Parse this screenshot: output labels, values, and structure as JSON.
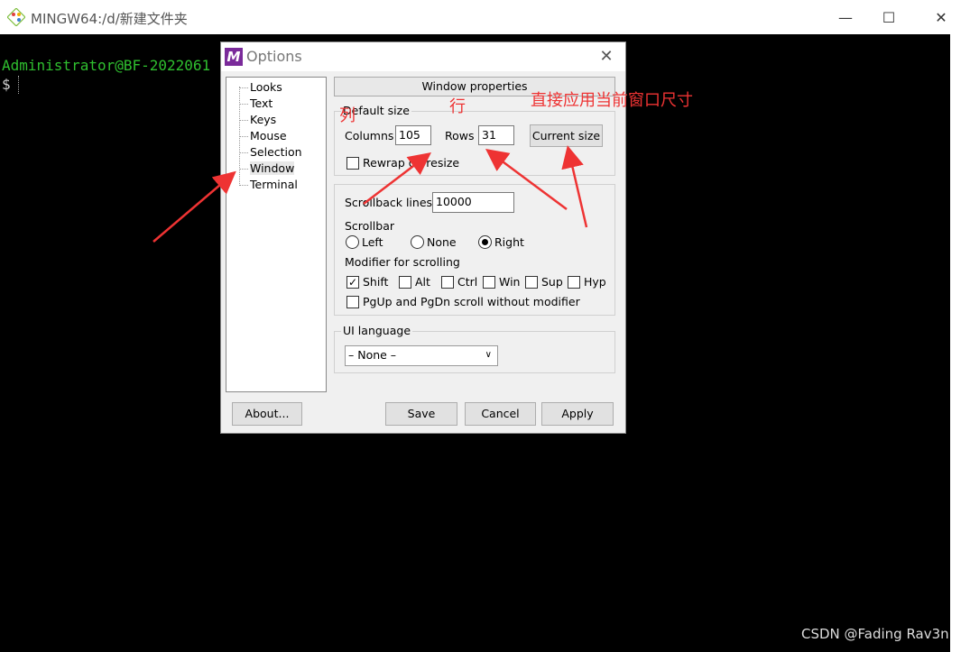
{
  "window": {
    "title": "MINGW64:/d/新建文件夹",
    "minimize": "—",
    "maximize": "☐",
    "close": "✕"
  },
  "terminal": {
    "line1": "Administrator@BF-2022061",
    "prompt": "$"
  },
  "dialog": {
    "title": "Options",
    "icon_letter": "M",
    "close": "✕",
    "nav": [
      "Looks",
      "Text",
      "Keys",
      "Mouse",
      "Selection",
      "Window",
      "Terminal"
    ],
    "selected_nav": "Window",
    "header": "Window properties",
    "default_size": {
      "label": "Default size",
      "columns_label": "Columns",
      "columns_value": "105",
      "rows_label": "Rows",
      "rows_value": "31",
      "current_size_button": "Current size",
      "rewrap_label": "Rewrap on resize",
      "rewrap_checked": false
    },
    "scrollback": {
      "lines_label": "Scrollback lines",
      "lines_value": "10000",
      "scrollbar_label": "Scrollbar",
      "scrollbar_options": [
        "Left",
        "None",
        "Right"
      ],
      "scrollbar_selected": "Right",
      "modifier_label": "Modifier for scrolling",
      "modifiers": [
        {
          "label": "Shift",
          "checked": true
        },
        {
          "label": "Alt",
          "checked": false
        },
        {
          "label": "Ctrl",
          "checked": false
        },
        {
          "label": "Win",
          "checked": false
        },
        {
          "label": "Sup",
          "checked": false
        },
        {
          "label": "Hyp",
          "checked": false
        }
      ],
      "pgup_label": "PgUp and PgDn scroll without modifier",
      "pgup_checked": false
    },
    "ui_language": {
      "label": "UI language",
      "value": "– None –"
    },
    "buttons": {
      "about": "About...",
      "save": "Save",
      "cancel": "Cancel",
      "apply": "Apply"
    }
  },
  "annotations": {
    "col": "列",
    "row": "行",
    "current": "直接应用当前窗口尺寸"
  },
  "watermark": "CSDN @Fading Rav3n",
  "colors": {
    "annotation": "#ee3333",
    "terminal_green": "#2fbf2f"
  }
}
